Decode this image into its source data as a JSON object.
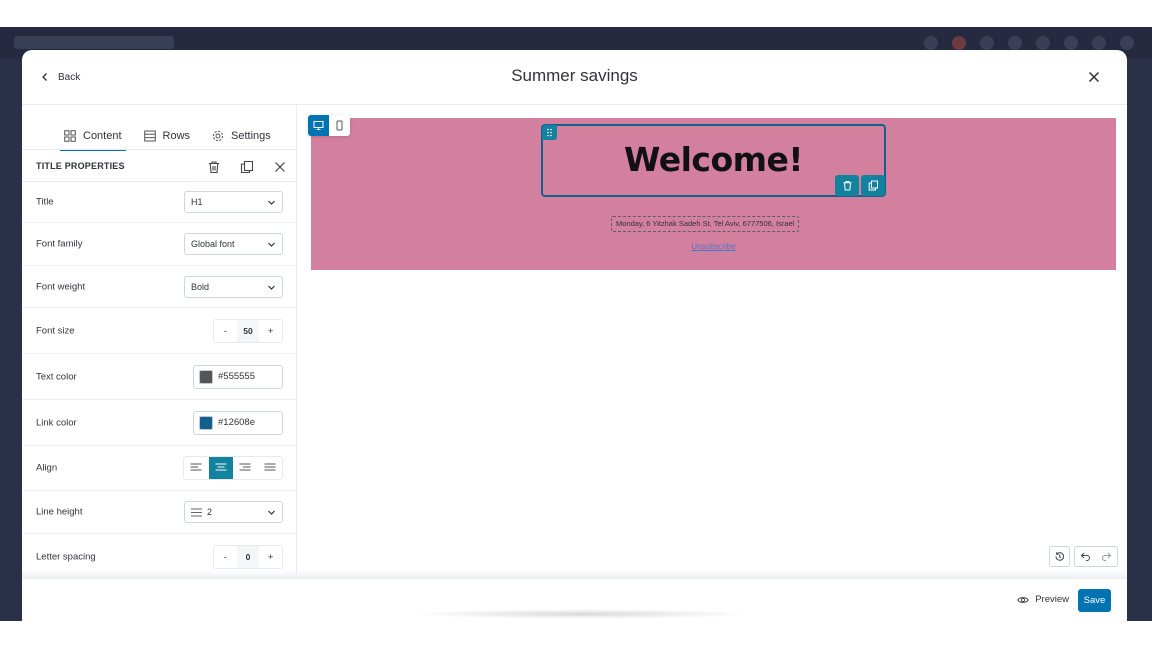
{
  "modal": {
    "back_label": "Back",
    "title": "Summer savings"
  },
  "tabs": [
    {
      "label": "Content",
      "icon": "grid-icon",
      "active": true
    },
    {
      "label": "Rows",
      "icon": "rows-icon",
      "active": false
    },
    {
      "label": "Settings",
      "icon": "gear-icon",
      "active": false
    }
  ],
  "properties": {
    "header": "TITLE PROPERTIES",
    "title": {
      "label": "Title",
      "value": "H1"
    },
    "font_family": {
      "label": "Font family",
      "value": "Global font"
    },
    "font_weight": {
      "label": "Font weight",
      "value": "Bold"
    },
    "font_size": {
      "label": "Font size",
      "value": "50",
      "minus": "-",
      "plus": "+"
    },
    "text_color": {
      "label": "Text color",
      "value": "#555555",
      "swatch": "#555555"
    },
    "link_color": {
      "label": "Link color",
      "value": "#12608e",
      "swatch": "#12608e"
    },
    "align": {
      "label": "Align",
      "selected": "center"
    },
    "line_height": {
      "label": "Line height",
      "value": "2"
    },
    "letter_spacing": {
      "label": "Letter spacing",
      "value": "0",
      "minus": "-",
      "plus": "+"
    }
  },
  "canvas": {
    "device_selected": "desktop",
    "hero_color": "#d3809f",
    "hero_title": "Welcome!",
    "address": "Monday, 6 Yitzhak Sadeh St, Tel Aviv, 6777506, Israel",
    "unsubscribe": "Unsubscribe"
  },
  "footer": {
    "preview_label": "Preview",
    "save_label": "Save"
  },
  "colors": {
    "accent": "#0073b1",
    "teal": "#12829e",
    "hero": "#d3809f"
  }
}
